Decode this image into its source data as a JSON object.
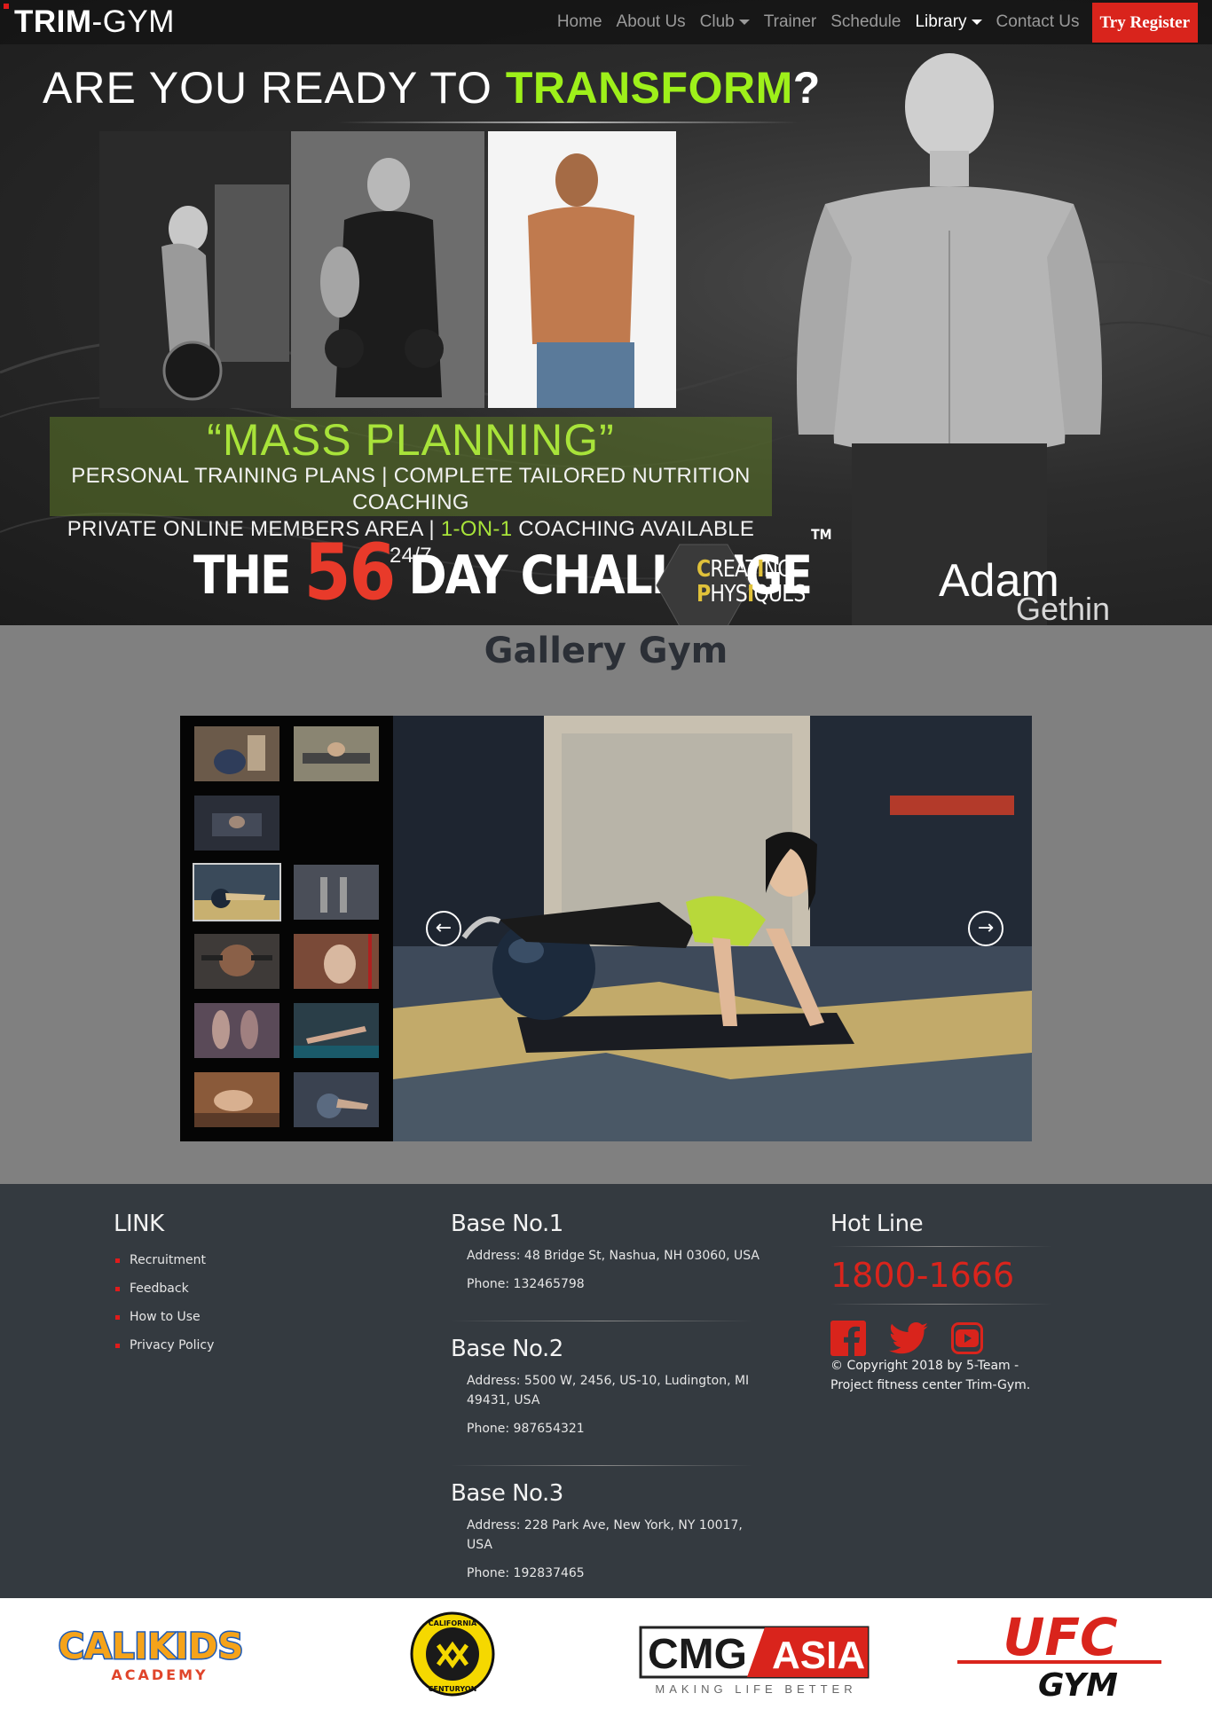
{
  "brand": {
    "bold": "TRIM",
    "rest": "-GYM"
  },
  "nav": {
    "items": [
      {
        "label": "Home"
      },
      {
        "label": "About Us"
      },
      {
        "label": "Club"
      },
      {
        "label": "Trainer"
      },
      {
        "label": "Schedule"
      },
      {
        "label": "Library"
      },
      {
        "label": "Contact Us"
      }
    ],
    "register": "Try Register"
  },
  "hero": {
    "title_pre": "ARE YOU READY TO ",
    "title_hl": "TRANSFORM",
    "title_q": "?",
    "mass_title": "“MASS PLANNING”",
    "mass_line1": "PERSONAL TRAINING PLANS | COMPLETE TAILORED NUTRITION COACHING",
    "mass_line2_a": "PRIVATE ONLINE MEMBERS AREA | ",
    "mass_line2_b": "1-ON-1",
    "mass_line2_c": " COACHING AVAILABLE 24/7",
    "challenge_a": "THE ",
    "challenge_num": "56",
    "challenge_b": " DAY CHALLENGE",
    "challenge_tm": "TM",
    "creating_1a": "C",
    "creating_1b": "REAT",
    "creating_1c": "I",
    "creating_1d": "NG",
    "creating_2a": "P",
    "creating_2b": "HYS",
    "creating_2c": "I",
    "creating_2d": "QUES",
    "signature_first": "Adam",
    "signature_last": "Gethin"
  },
  "gallery": {
    "title": "Gallery Gym",
    "prev_glyph": "←",
    "next_glyph": "→"
  },
  "footer": {
    "link_heading": "LINK",
    "links": [
      "Recruitment",
      "Feedback",
      "How to Use",
      "Privacy Policy"
    ],
    "bases": [
      {
        "title": "Base No.1",
        "address": "Address: 48 Bridge St, Nashua, NH 03060, USA",
        "phone": "Phone: 132465798"
      },
      {
        "title": "Base No.2",
        "address": "Address: 5500 W, 2456, US-10, Ludington, MI 49431, USA",
        "phone": "Phone: 987654321"
      },
      {
        "title": "Base No.3",
        "address": "Address: 228 Park Ave, New York, NY 10017, USA",
        "phone": "Phone: 192837465"
      }
    ],
    "hotline_heading": "Hot Line",
    "hotline": "1800-1666",
    "socials": [
      "facebook-icon",
      "twitter-icon",
      "youtube-icon"
    ],
    "copyright": "© Copyright 2018 by 5-Team - Project fitness center Trim-Gym."
  },
  "partners": {
    "calikids_1": "CALIKIDS",
    "calikids_2": "ACADEMY",
    "california_top": "CALIFORNIA",
    "california_bottom": "CENTURYON",
    "cmg_1": "CMG",
    "cmg_2": "ASIA",
    "cmg_tag": "MAKING LIFE BETTER",
    "ufc_1": "UFC",
    "ufc_2": "GYM"
  },
  "colors": {
    "accent_red": "#d9241c",
    "lime": "#9ef01a",
    "footer_bg": "#343a40",
    "gallery_bg": "#808080"
  }
}
